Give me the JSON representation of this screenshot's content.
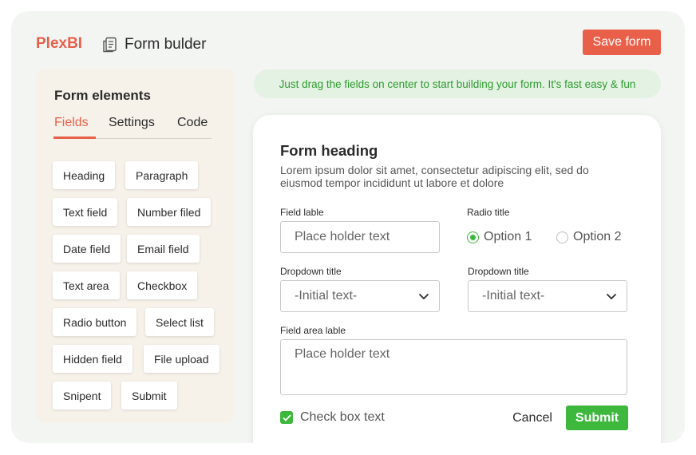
{
  "header": {
    "brand": "PlexBI",
    "title": "Form bulder",
    "title_icon": "document-icon",
    "save_label": "Save form"
  },
  "sidebar": {
    "title": "Form elements",
    "tabs": [
      {
        "label": "Fields",
        "active": true
      },
      {
        "label": "Settings",
        "active": false
      },
      {
        "label": "Code",
        "active": false
      }
    ],
    "elements": [
      "Heading",
      "Paragraph",
      "Text field",
      "Number filed",
      "Date field",
      "Email field",
      "Text area",
      "Checkbox",
      "Radio button",
      "Select list",
      "Hidden field",
      "File upload",
      "Snipent",
      "Submit"
    ]
  },
  "banner": {
    "text": "Just drag the fields on center to start building your form. It's fast easy & fun"
  },
  "form": {
    "heading": "Form heading",
    "description": "Lorem ipsum dolor sit amet, consectetur adipiscing elit, sed do eiusmod tempor incididunt ut labore et dolore",
    "field_label": "Field lable",
    "field_placeholder": "Place holder text",
    "radio_title": "Radio title",
    "radio_options": [
      {
        "label": "Option 1",
        "selected": true
      },
      {
        "label": "Option 2",
        "selected": false
      }
    ],
    "dropdown1": {
      "title": "Dropdown title",
      "value": "-Initial text-"
    },
    "dropdown2": {
      "title": "Dropdown title",
      "value": "-Initial text-"
    },
    "area_label": "Field area lable",
    "area_placeholder": "Place holder text",
    "checkbox_label": "Check box text",
    "checkbox_checked": true,
    "cancel_label": "Cancel",
    "submit_label": "Submit"
  },
  "colors": {
    "accent": "#e8604a",
    "success": "#3db83d",
    "banner_bg": "#e4f2e4",
    "sidebar_bg": "#f6f2ea"
  }
}
